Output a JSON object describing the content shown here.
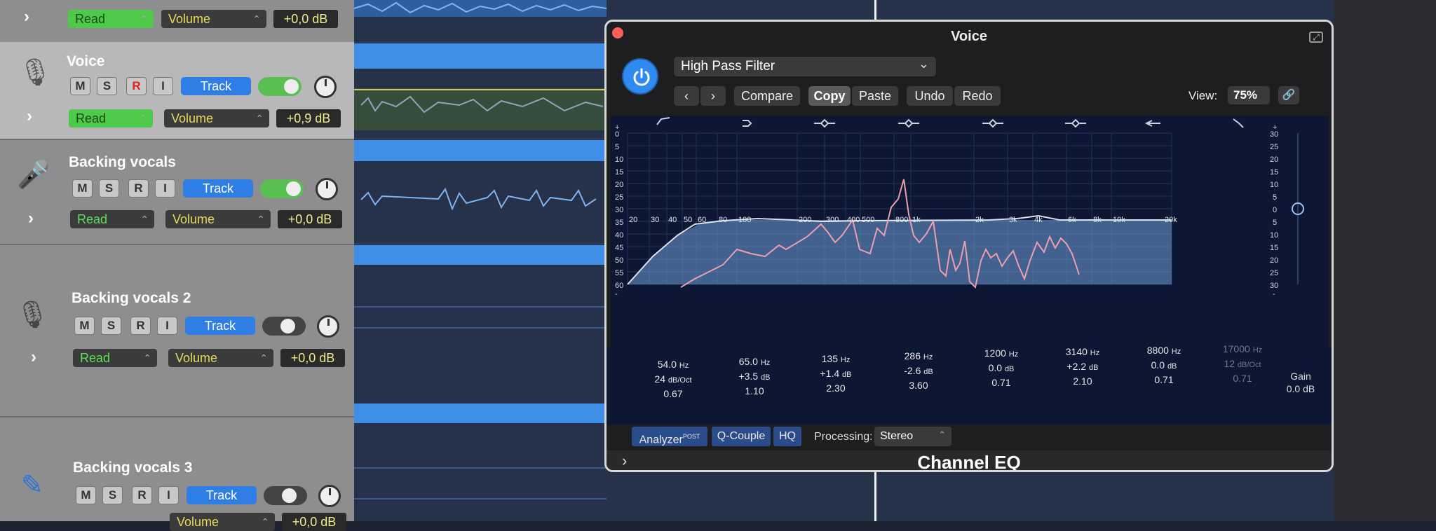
{
  "tracks": [
    {
      "name": "",
      "read": "Read",
      "volume": "Volume",
      "db": "+0,0 dB"
    },
    {
      "name": "Voice",
      "m": "M",
      "s": "S",
      "r": "R",
      "i": "I",
      "track": "Track",
      "read": "Read",
      "volume": "Volume",
      "db": "+0,9 dB"
    },
    {
      "name": "Backing vocals",
      "m": "M",
      "s": "S",
      "r": "R",
      "i": "I",
      "track": "Track",
      "read": "Read",
      "volume": "Volume",
      "db": "+0,0 dB"
    },
    {
      "name": "Backing vocals 2",
      "m": "M",
      "s": "S",
      "r": "R",
      "i": "I",
      "track": "Track",
      "read": "Read",
      "volume": "Volume",
      "db": "+0,0 dB"
    },
    {
      "name": "Backing vocals 3",
      "m": "M",
      "s": "S",
      "r": "R",
      "i": "I",
      "track": "Track",
      "volume": "Volume",
      "db": "+0,0 dB"
    }
  ],
  "plugin": {
    "title": "Voice",
    "preset": "High Pass Filter",
    "compare": "Compare",
    "copy": "Copy",
    "paste": "Paste",
    "undo": "Undo",
    "redo": "Redo",
    "view_label": "View:",
    "view_value": "75%",
    "name": "Channel EQ",
    "analyzer": "Analyzer",
    "analyzer_post": "POST",
    "qcouple": "Q-Couple",
    "hq": "HQ",
    "processing_label": "Processing:",
    "processing_value": "Stereo",
    "gain_label": "Gain",
    "gain_value": "0.0 dB"
  },
  "bands": [
    {
      "freq": "54.0",
      "unit": "Hz",
      "gain": "24",
      "gain_unit": "dB/Oct",
      "q": "0.67"
    },
    {
      "freq": "65.0",
      "unit": "Hz",
      "gain": "+3.5",
      "gain_unit": "dB",
      "q": "1.10"
    },
    {
      "freq": "135",
      "unit": "Hz",
      "gain": "+1.4",
      "gain_unit": "dB",
      "q": "2.30"
    },
    {
      "freq": "286",
      "unit": "Hz",
      "gain": "-2.6",
      "gain_unit": "dB",
      "q": "3.60"
    },
    {
      "freq": "1200",
      "unit": "Hz",
      "gain": "0.0",
      "gain_unit": "dB",
      "q": "0.71"
    },
    {
      "freq": "3140",
      "unit": "Hz",
      "gain": "+2.2",
      "gain_unit": "dB",
      "q": "2.10"
    },
    {
      "freq": "8800",
      "unit": "Hz",
      "gain": "0.0",
      "gain_unit": "dB",
      "q": "0.71"
    },
    {
      "freq": "17000",
      "unit": "Hz",
      "gain": "12",
      "gain_unit": "dB/Oct",
      "q": "0.71"
    }
  ],
  "freq_labels": [
    "20",
    "30",
    "40",
    "50",
    "60",
    "80",
    "100",
    "200",
    "300",
    "400",
    "500",
    "800",
    "1k",
    "2k",
    "3k",
    "4k",
    "6k",
    "8k",
    "10k",
    "20k"
  ],
  "left_scale": [
    "+",
    "0",
    "5",
    "10",
    "15",
    "20",
    "25",
    "30",
    "35",
    "40",
    "45",
    "50",
    "55",
    "60",
    "-"
  ],
  "right_scale": [
    "+",
    "30",
    "25",
    "20",
    "15",
    "10",
    "5",
    "0",
    "5",
    "10",
    "15",
    "20",
    "25",
    "30",
    "-"
  ]
}
